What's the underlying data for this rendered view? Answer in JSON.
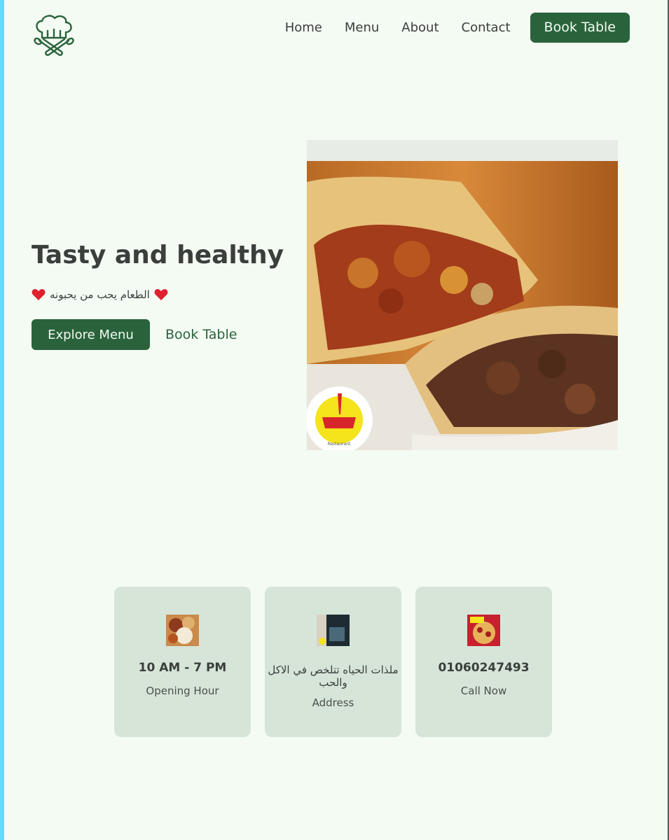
{
  "nav": {
    "links": [
      "Home",
      "Menu",
      "About",
      "Contact"
    ],
    "cta": "Book Table"
  },
  "hero": {
    "title": "Tasty and healthy",
    "tagline": "الطعام يحب من يحبونه",
    "primary_button": "Explore Menu",
    "secondary_button": "Book Table",
    "image_logo_text": "Restaurant"
  },
  "info_cards": [
    {
      "value": "10 AM - 7 PM",
      "label": "Opening Hour"
    },
    {
      "value": "ملذات الحياه تتلخص في الاكل والحب",
      "label": "Address"
    },
    {
      "value": "01060247493",
      "label": "Call Now"
    }
  ],
  "colors": {
    "brand_green": "#2a633b",
    "background": "#f3fbf3",
    "card_bg": "#d7e5d9",
    "accent_strip": "#5fdcff"
  },
  "icons": {
    "logo": "chef-hat-utensils-icon",
    "heart": "heart-icon"
  }
}
